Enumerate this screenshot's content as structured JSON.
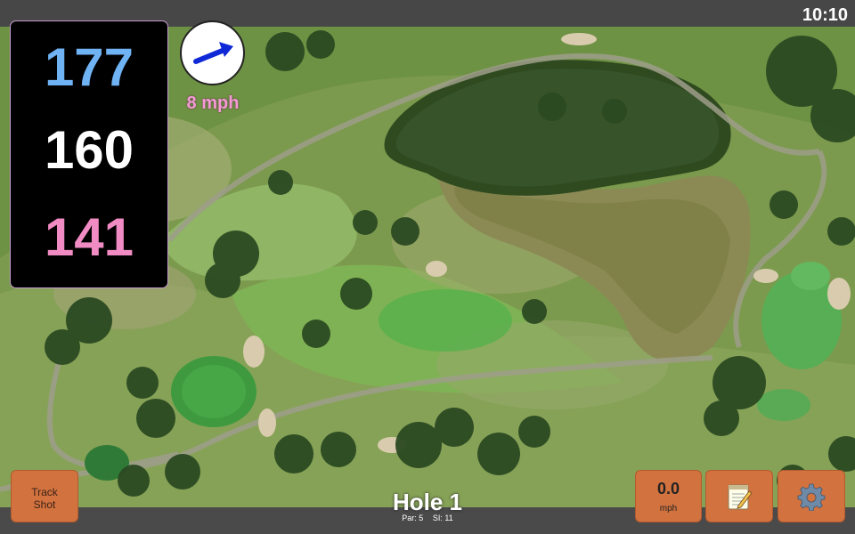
{
  "status_bar": {
    "time": "10:10"
  },
  "distances": {
    "back": "177",
    "center": "160",
    "front": "141"
  },
  "wind": {
    "speed": "8 mph",
    "direction_icon": "arrow-right-up-icon"
  },
  "hole": {
    "title": "Hole 1",
    "par": "Par: 5",
    "stroke_index": "SI: 11"
  },
  "buttons": {
    "track_shot_line1": "Track",
    "track_shot_line2": "Shot",
    "speed_value": "0.0",
    "speed_unit": "mph",
    "notes_icon": "notepad-icon",
    "settings_icon": "gear-icon"
  },
  "colors": {
    "back_distance": "#6fb3f5",
    "center_distance": "#ffffff",
    "front_distance": "#f08bc3",
    "wind_speed": "#f59ad4",
    "button_accent": "#d2723f"
  }
}
